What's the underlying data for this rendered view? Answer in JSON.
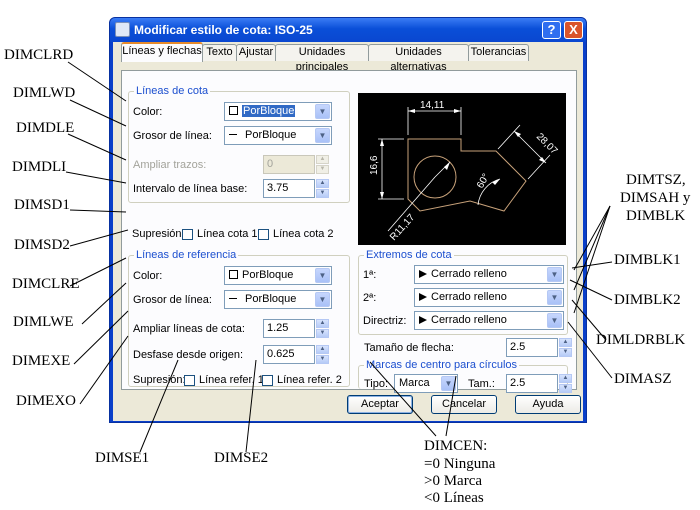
{
  "window": {
    "title": "Modificar estilo de cota: ISO-25",
    "help_label": "?",
    "close_label": "X"
  },
  "tabs": [
    {
      "label": "Líneas y flechas"
    },
    {
      "label": "Texto"
    },
    {
      "label": "Ajustar"
    },
    {
      "label": "Unidades principales"
    },
    {
      "label": "Unidades alternativas"
    },
    {
      "label": "Tolerancias"
    }
  ],
  "dim_lines": {
    "title": "Líneas de cota",
    "color_label": "Color:",
    "color_value": "PorBloque",
    "lineweight_label": "Grosor de línea:",
    "lineweight_value": "PorBloque",
    "extend_label": "Ampliar trazos:",
    "extend_value": "0",
    "baseline_label": "Intervalo de línea base:",
    "baseline_value": "3.75",
    "suppress_label": "Supresión:",
    "suppress_1": "Línea cota 1",
    "suppress_2": "Línea cota 2"
  },
  "ext_lines": {
    "title": "Líneas de referencia",
    "color_label": "Color:",
    "color_value": "PorBloque",
    "lineweight_label": "Grosor de línea:",
    "lineweight_value": "PorBloque",
    "extend_label": "Ampliar líneas de cota:",
    "extend_value": "1.25",
    "offset_label": "Desfase desde origen:",
    "offset_value": "0.625",
    "suppress_label": "Supresión:",
    "suppress_1": "Línea refer. 1",
    "suppress_2": "Línea refer. 2"
  },
  "preview": {
    "dim_top": "14,11",
    "dim_left": "16,6",
    "dim_right": "28,07",
    "dim_angle": "60°",
    "dim_radius": "R11,17"
  },
  "arrowheads": {
    "title": "Extremos de cota",
    "first_label": "1ª:",
    "first_value": "Cerrado relleno",
    "second_label": "2ª:",
    "second_value": "Cerrado relleno",
    "leader_label": "Directriz:",
    "leader_value": "Cerrado relleno",
    "size_label": "Tamaño de flecha:",
    "size_value": "2.5"
  },
  "center_marks": {
    "title": "Marcas de centro para círculos",
    "type_label": "Tipo:",
    "type_value": "Marca",
    "size_label": "Tam.:",
    "size_value": "2.5"
  },
  "buttons": {
    "accept": "Aceptar",
    "cancel": "Cancelar",
    "help": "Ayuda"
  },
  "callouts": {
    "dimclrd": "DIMCLRD",
    "dimlwd": "DIMLWD",
    "dimdle": "DIMDLE",
    "dimdli": "DIMDLI",
    "dimsd1": "DIMSD1",
    "dimsd2": "DIMSD2",
    "dimclre": "DIMCLRE",
    "dimlwe": "DIMLWE",
    "dimexe": "DIMEXE",
    "dimexo": "DIMEXO",
    "dimse1": "DIMSE1",
    "dimse2": "DIMSE2",
    "dimtsz_1": "DIMTSZ,",
    "dimtsz_2": "DIMSAH y",
    "dimtsz_3": "DIMBLK",
    "dimblk1": "DIMBLK1",
    "dimblk2": "DIMBLK2",
    "dimldrblk": "DIMLDRBLK",
    "dimasz": "DIMASZ",
    "dimcen_1": "DIMCEN:",
    "dimcen_2": "=0 Ninguna",
    "dimcen_3": ">0 Marca",
    "dimcen_4": "<0 Líneas"
  }
}
